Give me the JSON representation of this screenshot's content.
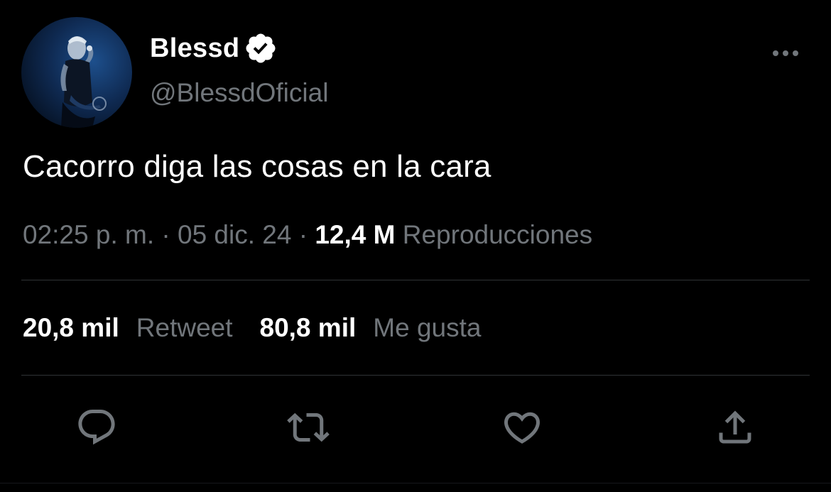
{
  "colors": {
    "background": "#000000",
    "primary_text": "#ffffff",
    "secondary_text": "#71767b",
    "divider": "#2f3336",
    "icon": "#71767b"
  },
  "author": {
    "display_name": "Blessd",
    "verified": true,
    "verified_icon": "verified-badge-icon",
    "handle": "@BlessdOficial",
    "avatar_icon": "profile-photo"
  },
  "more_menu_icon": "more-horizontal-icon",
  "tweet": {
    "text": "Cacorro diga las cosas en la cara"
  },
  "meta": {
    "time": "02:25 p. m.",
    "separator_1": " · ",
    "date": "05 dic. 24",
    "separator_2": " · ",
    "views_count": "12,4 M",
    "views_label": "Reproducciones"
  },
  "stats": {
    "retweets_count": "20,8 mil",
    "retweets_label": "Retweet",
    "likes_count": "80,8 mil",
    "likes_label": "Me gusta"
  },
  "actions": [
    {
      "name": "reply",
      "icon": "reply-icon"
    },
    {
      "name": "retweet",
      "icon": "retweet-icon"
    },
    {
      "name": "like",
      "icon": "heart-icon"
    },
    {
      "name": "share",
      "icon": "share-icon"
    }
  ]
}
